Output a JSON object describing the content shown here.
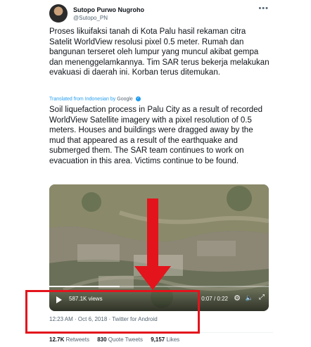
{
  "tweet": {
    "author_name": "Sutopo Purwo Nugroho",
    "author_handle": "@Sutopo_PN",
    "more_icon": "more-icon",
    "original_text": "Proses likuifaksi tanah di Kota Palu hasil rekaman citra Satelit WorldView resolusi pixel 0.5 meter. Rumah dan bangunan terseret oleh lumpur yang muncul akibat gempa dan menenggelamkannya. Tim SAR terus bekerja melakukan evakuasi di daerah ini. Korban terus ditemukan.",
    "translated_prefix": "Translated from Indonesian by",
    "translated_service": "Google",
    "translated_text": "Soil liquefaction process in Palu City as a result of recorded WorldView Satellite imagery with a pixel resolution of 0.5 meters. Houses and buildings were dragged away by the mud that appeared as a result of the earthquake and submerged them. The SAR team continues to work on evacuation in this area. Victims continue to be found.",
    "timestamp": "12:23 AM · Oct 6, 2018 · Twitter for Android"
  },
  "video": {
    "views": "587.1K views",
    "time": "0:07 / 0:22",
    "progress": 0.32,
    "icons": [
      "play-icon",
      "settings-icon",
      "volume-icon",
      "fullscreen-icon"
    ]
  },
  "stats": {
    "retweets_count": "12.7K",
    "retweets_label": "Retweets",
    "quotes_count": "830",
    "quotes_label": "Quote Tweets",
    "likes_count": "9,157",
    "likes_label": "Likes"
  },
  "annotation": {
    "color": "#e3141c"
  }
}
